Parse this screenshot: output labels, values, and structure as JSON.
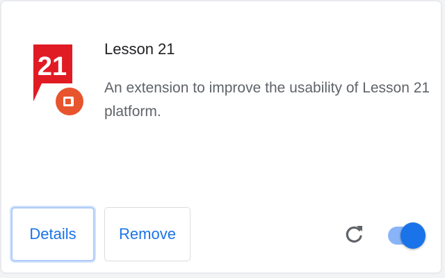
{
  "extension": {
    "logo_text": "21",
    "name": "Lesson 21",
    "description": "An extension to improve the usability of Lesson 21 platform."
  },
  "buttons": {
    "details_label": "Details",
    "remove_label": "Remove"
  },
  "icons": {
    "logo": "lesson21-logo-icon",
    "reload": "reload-icon",
    "toggle": "toggle-switch"
  },
  "toggle": {
    "enabled": true
  },
  "colors": {
    "accent": "#1a73e8",
    "logo_red": "#e01b24",
    "logo_orange": "#e8542e"
  }
}
